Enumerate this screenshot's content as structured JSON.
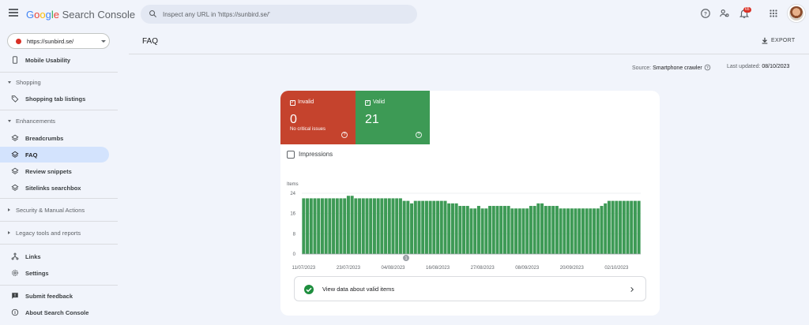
{
  "header": {
    "logo": {
      "g1": "G",
      "g2": "o",
      "g3": "o",
      "g4": "g",
      "g5": "l",
      "g6": "e",
      "product": "Search Console"
    },
    "search_placeholder": "Inspect any URL in 'https://sunbird.se/'",
    "notification_count": "65",
    "icons": [
      "menu-icon",
      "search-icon",
      "help-icon",
      "manage-users-icon",
      "notifications-icon",
      "apps-icon",
      "avatar"
    ]
  },
  "sidebar": {
    "property": "https://sunbird.se/",
    "mobile_usability": "Mobile Usability",
    "shopping": "Shopping",
    "shopping_tab": "Shopping tab listings",
    "enhancements": "Enhancements",
    "breadcrumbs": "Breadcrumbs",
    "faq": "FAQ",
    "review_snippets": "Review snippets",
    "sitelinks": "Sitelinks searchbox",
    "security": "Security & Manual Actions",
    "legacy": "Legacy tools and reports",
    "links": "Links",
    "settings": "Settings",
    "feedback": "Submit feedback",
    "about": "About Search Console"
  },
  "main": {
    "title": "FAQ",
    "export": "EXPORT",
    "source_label": "Source:",
    "source_value": "Smartphone crawler",
    "updated_label": "Last updated:",
    "updated_value": "08/10/2023",
    "invalid": {
      "label": "Invalid",
      "count": "0",
      "sub": "No critical issues",
      "check": "✓",
      "help": "?"
    },
    "valid": {
      "label": "Valid",
      "count": "21",
      "check": "✓",
      "help": "?"
    },
    "impressions": "Impressions",
    "view_data": "View data about valid items"
  },
  "colors": {
    "invalid": "#c5432d",
    "valid": "#3d9a55",
    "active_nav": "#d3e3fd"
  },
  "chart_data": {
    "type": "bar",
    "ylabel": "Items",
    "ylim": [
      0,
      24
    ],
    "yticks": [
      "24",
      "16",
      "8",
      "0"
    ],
    "xticks": [
      "11/07/2023",
      "23/07/2023",
      "04/08/2023",
      "16/08/2023",
      "27/08/2023",
      "08/09/2023",
      "20/09/2023",
      "02/10/2023"
    ],
    "annotation": "1",
    "series": [
      {
        "values": [
          22,
          22,
          22,
          22,
          22,
          22,
          22,
          22,
          22,
          22,
          22,
          22,
          23,
          23,
          22,
          22,
          22,
          22,
          22,
          22,
          22,
          22,
          22,
          22,
          22,
          22,
          22,
          21,
          21,
          20,
          21,
          21,
          21,
          21,
          21,
          21,
          21,
          21,
          21,
          20,
          20,
          20,
          19,
          19,
          19,
          18,
          18,
          19,
          18,
          18,
          19,
          19,
          19,
          19,
          19,
          19,
          18,
          18,
          18,
          18,
          18,
          19,
          19,
          20,
          20,
          19,
          19,
          19,
          19,
          18,
          18,
          18,
          18,
          18,
          18,
          18,
          18,
          18,
          18,
          18,
          19,
          20,
          21,
          21,
          21,
          21,
          21,
          21,
          21,
          21,
          21
        ]
      }
    ]
  }
}
